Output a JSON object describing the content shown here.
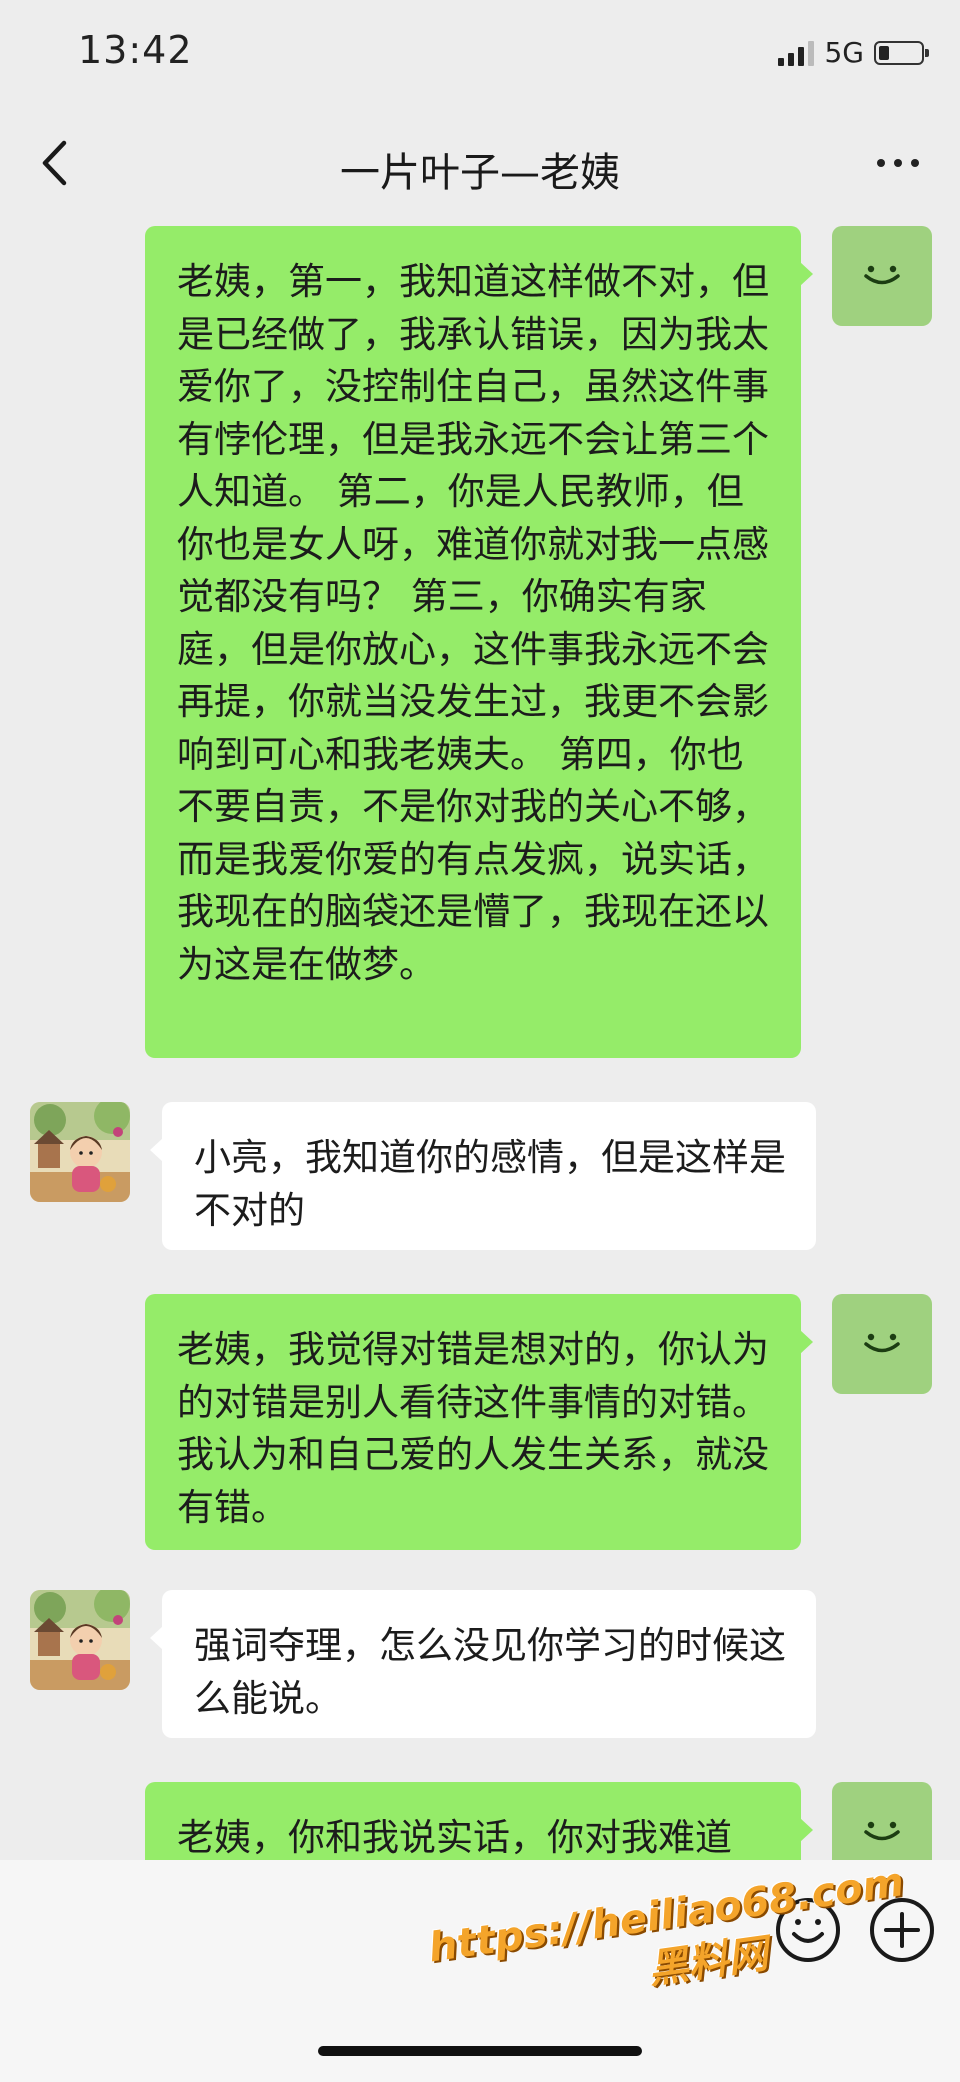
{
  "status_bar": {
    "time": "13:42",
    "network": "5G",
    "battery_level": 0.25
  },
  "header": {
    "title": "一片叶子—老姨",
    "back_icon": "chevron-left-icon",
    "more_icon": "more-dots-icon"
  },
  "messages": [
    {
      "side": "sent",
      "text": "老姨，第一，我知道这样做不对，但是已经做了，我承认错误，因为我太爱你了，没控制住自己，虽然这件事有悖伦理，但是我永远不会让第三个人知道。 第二，你是人民教师，但你也是女人呀，难道你就对我一点感觉都没有吗？ 第三，你确实有家庭，但是你放心，这件事我永远不会再提，你就当没发生过，我更不会影响到可心和我老姨夫。 第四，你也不要自责，不是你对我的关心不够，而是我爱你爱的有点发疯，说实话，我现在的脑袋还是懵了，我现在还以为这是在做梦。"
    },
    {
      "side": "received",
      "text": "小亮，我知道你的感情，但是这样是不对的"
    },
    {
      "side": "sent",
      "text": "老姨，我觉得对错是想对的，你认为的对错是别人看待这件事情的对错。我认为和自己爱的人发生关系，就没有错。"
    },
    {
      "side": "received",
      "text": "强词夺理，怎么没见你学习的时候这么能说。"
    },
    {
      "side": "sent",
      "text": "老姨，你和我说实话，你对我难道"
    }
  ],
  "input_bar": {
    "emoji_icon": "emoji-smile-icon",
    "plus_icon": "plus-circle-icon"
  },
  "watermark": {
    "url": "https://heiliao68.com",
    "name": "黑料网"
  },
  "colors": {
    "sent_bubble": "#95ec69",
    "received_bubble": "#ffffff",
    "background": "#ededed",
    "watermark": "#f4a42a"
  }
}
